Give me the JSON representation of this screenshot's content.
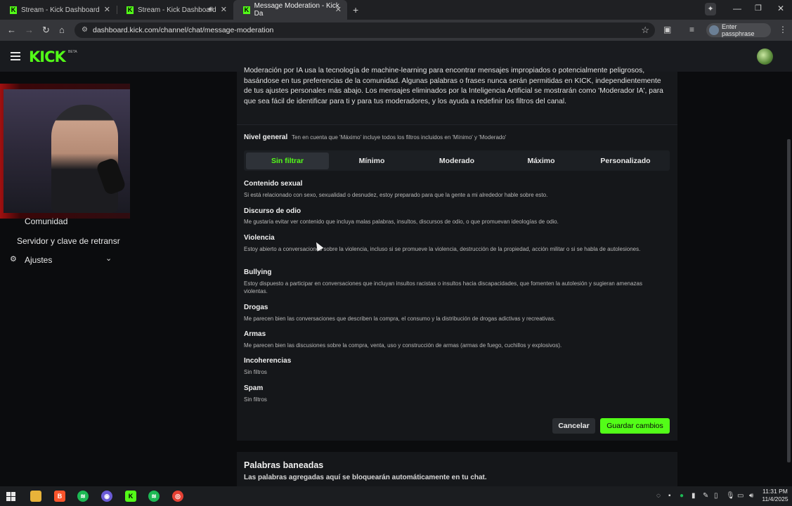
{
  "browser": {
    "tabs": [
      {
        "title": "Stream - Kick Dashboard",
        "active": false
      },
      {
        "title": "Stream - Kick Dashboard",
        "active": false,
        "audio": true
      },
      {
        "title": "Message Moderation - Kick Da",
        "active": true
      }
    ],
    "url": "dashboard.kick.com/channel/chat/message-moderation",
    "profile_label": "Enter passphrase",
    "window_controls": [
      "minimize",
      "maximize",
      "close"
    ]
  },
  "header": {
    "logo": "KICK",
    "badge": "BETA"
  },
  "sidebar": {
    "items": [
      {
        "label": "Comunidad"
      },
      {
        "label": "Servidor y clave de retransr"
      },
      {
        "label": "Ajustes"
      }
    ]
  },
  "moderation": {
    "intro": "Moderación por IA usa la tecnología de machine-learning para encontrar mensajes impropiados o potencialmente peligrosos, basándose en tus preferencias de la comunidad. Algunas palabras o frases nunca serán permitidas en KICK, independientemente de tus ajustes personales más abajo. Los mensajes eliminados por la Inteligencia Artificial se mostrarán como 'Moderador IA', para que sea fácil de identificar para ti y para tus moderadores, y los ayuda a redefinir los filtros del canal.",
    "level_label": "Nivel general",
    "level_hint": "Ten en cuenta que 'Máximo' incluye todos los filtros incluidos en 'Mínimo' y 'Moderado'",
    "levels": [
      "Sin filtrar",
      "Mínimo",
      "Moderado",
      "Máximo",
      "Personalizado"
    ],
    "selected_level": "Sin filtrar",
    "categories": [
      {
        "title": "Contenido sexual",
        "desc": "Si está relacionado con sexo, sexualidad o desnudez, estoy preparado para que la gente a mi alrededor hable sobre esto."
      },
      {
        "title": "Discurso de odio",
        "desc": "Me gustaría evitar ver contenido que incluya malas palabras, insultos, discursos de odio, o que promuevan ideologías de odio."
      },
      {
        "title": "Violencia",
        "desc": "Estoy abierto a conversaciones sobre la violencia, incluso si se promueve la violencia, destrucción de la propiedad, acción militar o si se habla de autolesiones."
      },
      {
        "title": "Bullying",
        "desc": "Estoy dispuesto a participar en conversaciones que incluyan insultos racistas o insultos hacia discapacidades, que fomenten la autolesión y sugieran amenazas violentas."
      },
      {
        "title": "Drogas",
        "desc": "Me parecen bien las conversaciones que describen la compra, el consumo y la distribución de drogas adictivas y recreativas."
      },
      {
        "title": "Armas",
        "desc": "Me parecen bien las discusiones sobre la compra, venta, uso y construcción de armas (armas de fuego, cuchillos y explosivos)."
      },
      {
        "title": "Incoherencias",
        "desc": "Sin filtros"
      },
      {
        "title": "Spam",
        "desc": "Sin filtros"
      }
    ],
    "cancel_label": "Cancelar",
    "save_label": "Guardar cambios"
  },
  "banned_words": {
    "title": "Palabras baneadas",
    "desc": "Las palabras agregadas aquí se bloquearán automáticamente en tu chat."
  },
  "taskbar": {
    "time": "11:31 PM",
    "date": "11/4/2025"
  },
  "colors": {
    "accent": "#53fc18",
    "background": "#0b0c0e",
    "card": "#15171a"
  }
}
